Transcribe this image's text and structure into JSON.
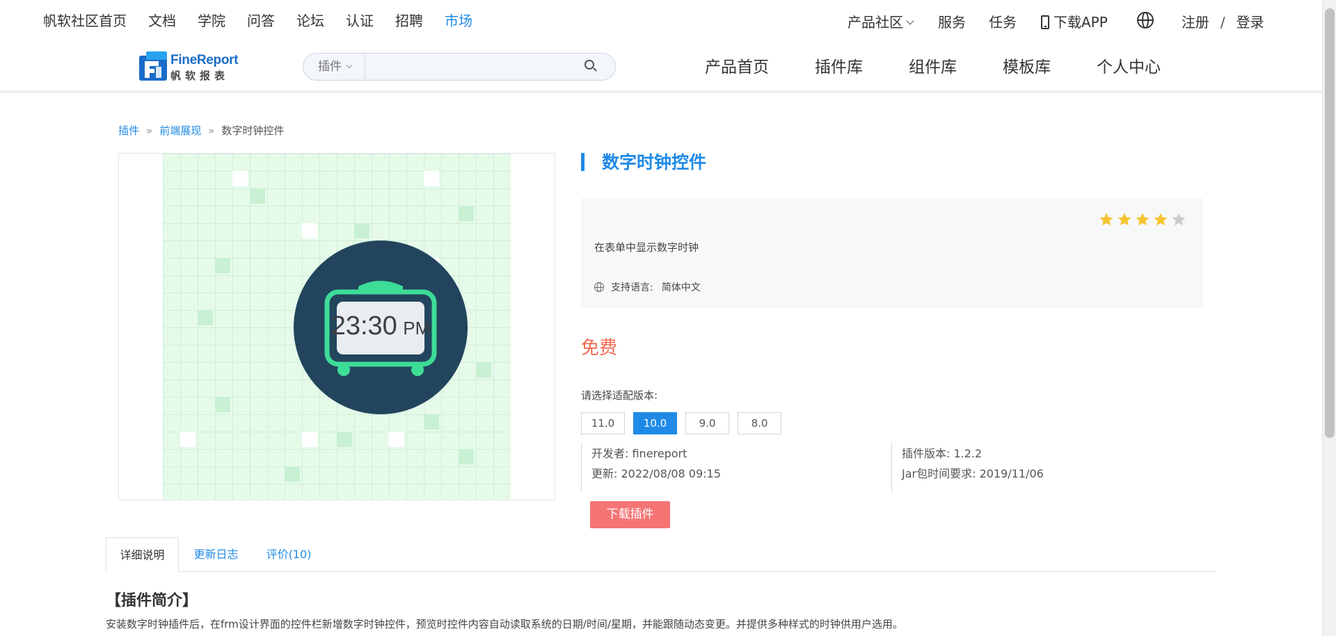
{
  "topnav": {
    "left_items": [
      {
        "label": "帆软社区首页",
        "active": false
      },
      {
        "label": "文档",
        "active": false
      },
      {
        "label": "学院",
        "active": false
      },
      {
        "label": "问答",
        "active": false
      },
      {
        "label": "论坛",
        "active": false
      },
      {
        "label": "认证",
        "active": false
      },
      {
        "label": "招聘",
        "active": false
      },
      {
        "label": "市场",
        "active": true
      }
    ],
    "community": "产品社区",
    "service": "服务",
    "task": "任务",
    "download_app": "下载APP",
    "register": "注册",
    "divider": "/",
    "login": "登录"
  },
  "logo": {
    "line1": "FineReport",
    "line2": "帆软报表"
  },
  "search": {
    "category": "插件",
    "placeholder": "",
    "value": ""
  },
  "mainnav": [
    "产品首页",
    "插件库",
    "组件库",
    "模板库",
    "个人中心"
  ],
  "breadcrumb": {
    "items": [
      "插件",
      "前端展现"
    ],
    "separator": "»",
    "current": "数字时钟控件"
  },
  "preview": {
    "clock_time": "23:30",
    "clock_suffix": "PM"
  },
  "plugin": {
    "title": "数字时钟控件",
    "rating": 4,
    "rating_max": 5,
    "description": "在表单中显示数字时钟",
    "language_label": "支持语言:",
    "language_value": "简体中文",
    "price": "免费",
    "version_prompt": "请选择适配版本:",
    "versions": [
      "11.0",
      "10.0",
      "9.0",
      "8.0"
    ],
    "selected_version": "10.0",
    "developer": "开发者:  finereport",
    "updated": "更新:  2022/08/08 09:15",
    "plugin_version": "插件版本:  1.2.2",
    "jar_requirement": "Jar包时间要求:  2019/11/06",
    "download_button": "下载插件"
  },
  "tabs": {
    "details": "详细说明",
    "changelog": "更新日志",
    "reviews": "评价(10)"
  },
  "intro": {
    "heading": "【插件简介】",
    "text": "安装数字时钟插件后，在frm设计界面的控件栏新增数字时钟控件，预览时控件内容自动读取系统的日期/时间/星期，并能跟随动态变更。并提供多种样式的时钟供用户选用。"
  },
  "colors": {
    "accent": "#1f8ae6",
    "price": "#f06a4f",
    "download": "#f57575",
    "star_on": "#f6c532",
    "star_off": "#cccccc",
    "clock_bg": "#22455d",
    "clock_frame": "#3ddc97"
  }
}
